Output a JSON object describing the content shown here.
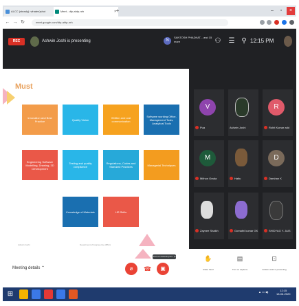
{
  "browser": {
    "tabs": [
      {
        "title": "ALCC (steady): whaten)shot"
      },
      {
        "title": "Meet - dtp-ahtp-nrh"
      }
    ],
    "url": "meet.google.com/dtp-ahtp-nrh"
  },
  "meet": {
    "recording_badge": "REC",
    "presenting_text": "Ashwin Joshi is presenting",
    "top_participant": {
      "initial": "N",
      "name": "SANTOSH PHADKAT... and 15 more"
    },
    "clock": "12:15 PM",
    "slide": {
      "title": "Must",
      "tiles": [
        {
          "text": "Innovation and Best Practice",
          "color": "#f39c4a"
        },
        {
          "text": "Quality Vision",
          "color": "#29b6e8"
        },
        {
          "text": "Written and oral communication",
          "color": "#f6a21f"
        },
        {
          "text": "Software working Office, Management Tools, Analytical Tools",
          "color": "#1a6fb0"
        },
        {
          "text": "Engineering Software Modelling, Drawing, 3D Development",
          "color": "#ea5848"
        },
        {
          "text": "Testing and quality compliance",
          "color": "#29b6e8"
        },
        {
          "text": "Regulations, Codes and Standard Practices",
          "color": "#27a9d9"
        },
        {
          "text": "Managerial Techniques",
          "color": "#f39c1f"
        },
        {
          "text": "Knowledge of Materials",
          "color": "#1a6fb0"
        },
        {
          "text": "HR Skills",
          "color": "#ea5848"
        }
      ],
      "footer_left": "Ashwin Joshi",
      "footer_mid": "Department of Engineering (BSC)"
    },
    "participants": [
      {
        "name": "Pua",
        "initial": "V",
        "avatar_color": "#8e44ad"
      },
      {
        "name": "Ashwin Joshi",
        "initial": "",
        "avatar_color": "#2a3a2a"
      },
      {
        "name": "Rohit Kumar add",
        "initial": "R",
        "avatar_color": "#e05a6a"
      },
      {
        "name": "Mithun Grada",
        "initial": "M",
        "avatar_color": "#1e5a3a"
      },
      {
        "name": "Haltu",
        "initial": "",
        "avatar_color": "#7a5a3a"
      },
      {
        "name": "Darshan K",
        "initial": "D",
        "avatar_color": "#7a6a5a"
      },
      {
        "name": "Zaynee Shaikh",
        "initial": "",
        "avatar_color": "#ddd"
      },
      {
        "name": "Gomathi kumar GK",
        "initial": "",
        "avatar_color": "#8c6cd0"
      },
      {
        "name": "SHIDYAG Y. JAIS",
        "initial": "",
        "avatar_color": "#3a3a3a"
      }
    ],
    "bottom": {
      "meeting_details": "Meeting details",
      "tooltip": "Turn on camera (ctrl + e)",
      "actions": [
        {
          "icon": "raise-hand-icon",
          "label": "Raise hand"
        },
        {
          "icon": "captions-icon",
          "label": "Turn on captions"
        },
        {
          "icon": "present-icon",
          "label": "Ashwin Joshi is presenting"
        }
      ]
    }
  },
  "taskbar": {
    "time": "12:15",
    "date": "18-06-2020"
  }
}
